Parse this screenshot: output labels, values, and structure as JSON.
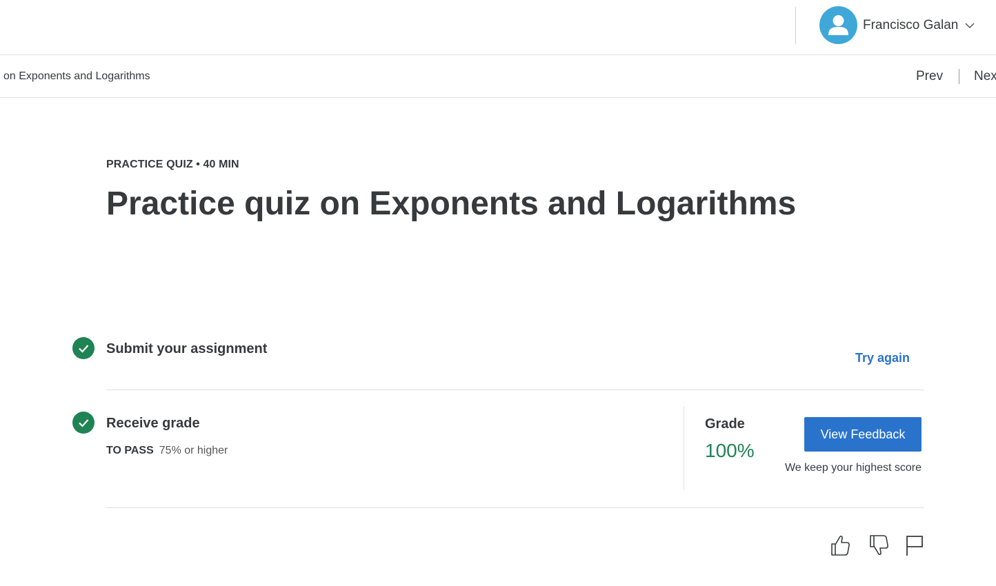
{
  "header": {
    "user_name": "Francisco Galan",
    "avatar_icon": "user-avatar-icon",
    "dropdown_icon": "chevron-down-icon"
  },
  "subnav": {
    "breadcrumb": "on Exponents and Logarithms",
    "prev_label": "Prev",
    "next_label": "Nex"
  },
  "quiz": {
    "eyebrow": "PRACTICE QUIZ • 40 MIN",
    "title": "Practice quiz on Exponents and Logarithms"
  },
  "steps": {
    "submit": {
      "label": "Submit your assignment",
      "action": "Try again"
    },
    "grade": {
      "label": "Receive grade",
      "to_pass_label": "TO PASS",
      "to_pass_value": "75% or higher",
      "grade_label": "Grade",
      "grade_value": "100%",
      "button": "View Feedback",
      "note": "We keep your highest score"
    }
  },
  "feedback_icons": [
    "thumbs-up-icon",
    "thumbs-down-icon",
    "flag-icon"
  ],
  "colors": {
    "accent": "#2a73cc",
    "success": "#1f8354",
    "text": "#373a3c",
    "avatar": "#3fa8d8"
  }
}
